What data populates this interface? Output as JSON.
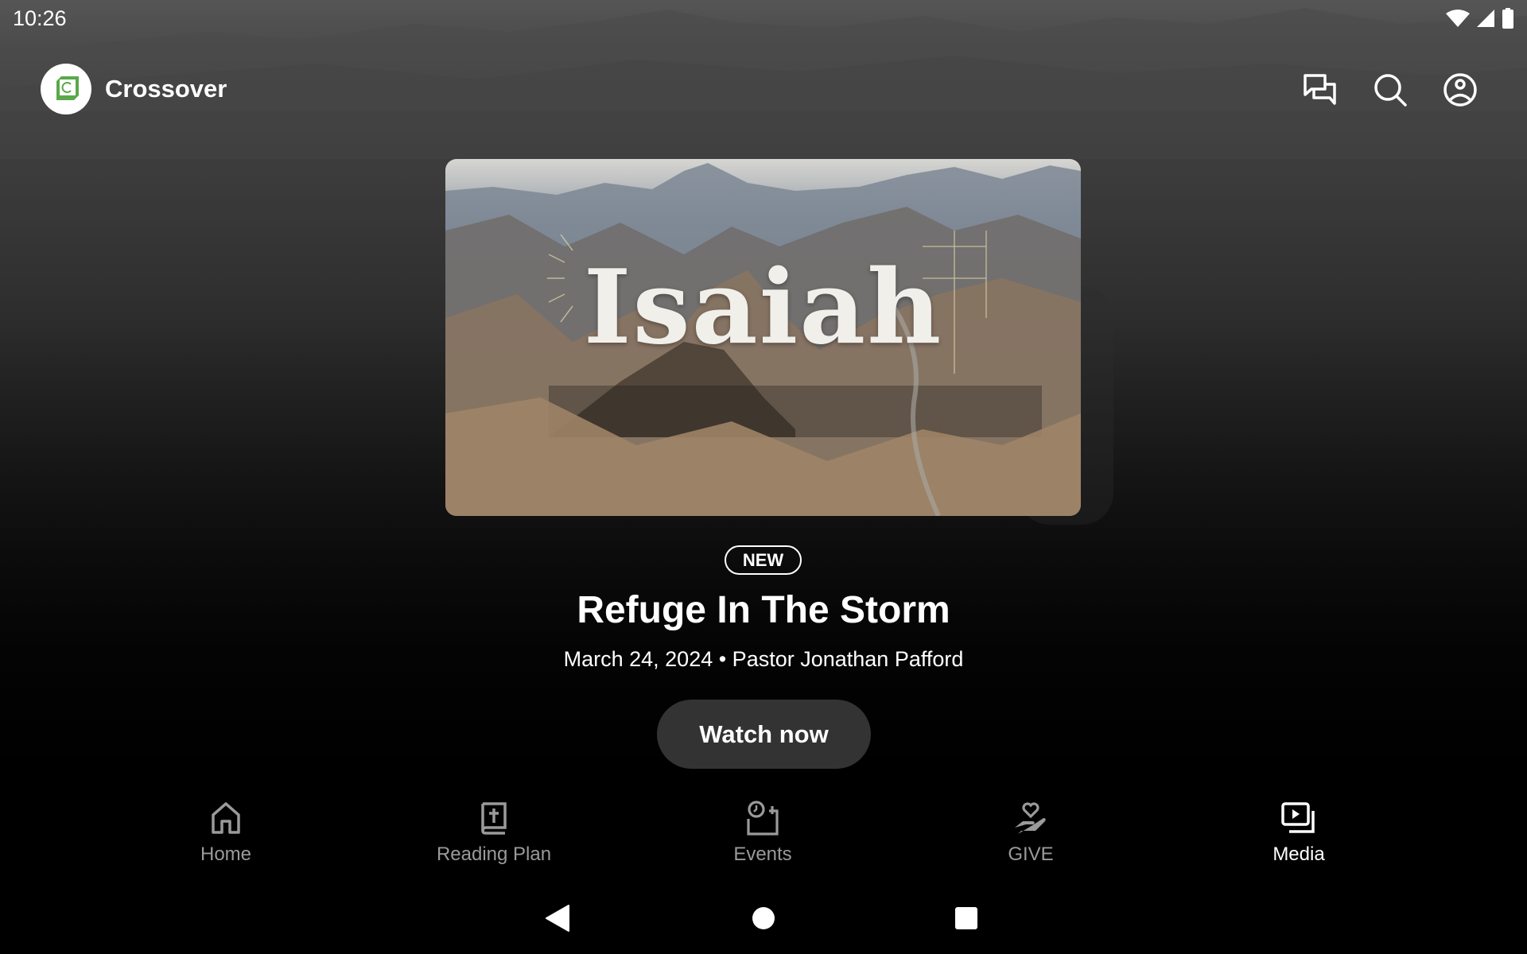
{
  "status_bar": {
    "time": "10:26",
    "icons": [
      "wifi-icon",
      "cell-signal-icon",
      "battery-icon"
    ]
  },
  "header": {
    "app_name": "Crossover",
    "logo_icon": "crossover-logo",
    "logo_color": "#5aa84a",
    "actions": [
      {
        "name": "chat-button",
        "icon": "chat-bubbles-icon"
      },
      {
        "name": "search-button",
        "icon": "search-icon"
      },
      {
        "name": "profile-button",
        "icon": "account-circle-icon"
      }
    ]
  },
  "featured": {
    "artwork_title": "Isaiah",
    "badge": "NEW",
    "title": "Refuge In The Storm",
    "meta": "March 24, 2024 • Pastor Jonathan Pafford",
    "cta_label": "Watch now"
  },
  "bottom_nav": {
    "items": [
      {
        "label": "Home",
        "icon": "home-icon",
        "active": false
      },
      {
        "label": "Reading Plan",
        "icon": "bible-icon",
        "active": false
      },
      {
        "label": "Events",
        "icon": "calendar-clock-icon",
        "active": false
      },
      {
        "label": "GIVE",
        "icon": "giving-hand-heart-icon",
        "active": false
      },
      {
        "label": "Media",
        "icon": "media-library-icon",
        "active": true
      }
    ],
    "active_color": "#ffffff",
    "inactive_color": "#9a9a9a"
  },
  "system_nav": {
    "buttons": [
      "back-icon",
      "home-circle-icon",
      "recents-icon"
    ]
  }
}
